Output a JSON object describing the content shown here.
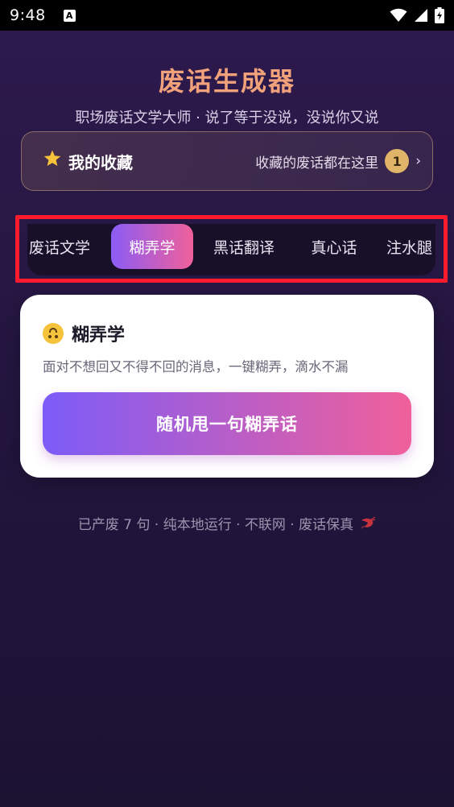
{
  "status_bar": {
    "time": "9:48",
    "notification_icon": "A"
  },
  "header": {
    "title": "废话生成器",
    "subtitle": "职场废话文学大师 · 说了等于没说，没说你又说"
  },
  "favorites": {
    "icon": "star-icon",
    "title": "我的收藏",
    "description": "收藏的废话都在这里",
    "count": "1",
    "chevron": "›"
  },
  "tabs": [
    {
      "label": "废话文学",
      "active": false
    },
    {
      "label": "糊弄学",
      "active": true
    },
    {
      "label": "黑话翻译",
      "active": false
    },
    {
      "label": "真心话",
      "active": false
    },
    {
      "label": "注水腿",
      "active": false
    }
  ],
  "card": {
    "icon": "upside-down-face-icon",
    "title": "糊弄学",
    "description": "面对不想回又不得不回的消息，一键糊弄，滴水不漏",
    "button_label": "随机甩一句糊弄话"
  },
  "footer": {
    "text": "已产废 7 句 · 纯本地运行 · 不联网 · 废话保真",
    "icon": "shrimp-icon"
  },
  "colors": {
    "accent_start": "#7c5cf8",
    "accent_end": "#f0609a",
    "title": "#f2a27a",
    "highlight_border": "#ff1a2e"
  }
}
